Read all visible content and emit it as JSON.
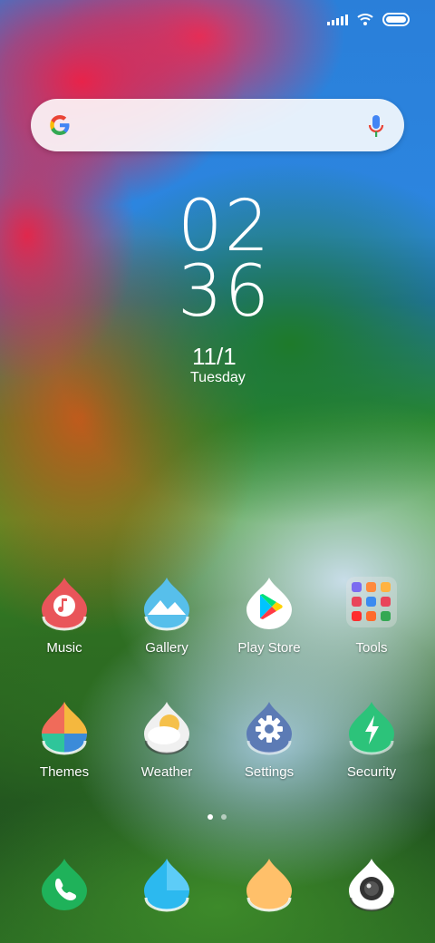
{
  "status_bar": {
    "signal_icon": "cellular-signal-icon",
    "wifi_icon": "wifi-icon",
    "battery_icon": "battery-icon"
  },
  "search_widget": {
    "logo": "google-g-logo",
    "mic_icon": "microphone-icon"
  },
  "clock": {
    "hours": "02",
    "minutes": "36",
    "date": "11/1",
    "day": "Tuesday"
  },
  "apps_row1": [
    {
      "label": "Music",
      "icon": "music-icon",
      "color": "#e9555a"
    },
    {
      "label": "Gallery",
      "icon": "gallery-icon",
      "color": "#2ea8e0"
    },
    {
      "label": "Play Store",
      "icon": "play-store-icon",
      "color": "#ffffff"
    },
    {
      "label": "Tools",
      "icon": "folder-icon",
      "color": "#d8d8d8"
    }
  ],
  "apps_row2": [
    {
      "label": "Themes",
      "icon": "themes-icon",
      "color": "#f06b5a"
    },
    {
      "label": "Weather",
      "icon": "weather-icon",
      "color": "#f0f0f0"
    },
    {
      "label": "Settings",
      "icon": "settings-icon",
      "color": "#5c7bb5"
    },
    {
      "label": "Security",
      "icon": "security-icon",
      "color": "#2cc37a"
    }
  ],
  "page_indicator": {
    "pages": 2,
    "current": 1
  },
  "dock": [
    {
      "icon": "phone-icon",
      "color": "#1fb25a"
    },
    {
      "icon": "messaging-icon",
      "color": "#2cb9ef"
    },
    {
      "icon": "browser-icon",
      "color": "#ffc06a"
    },
    {
      "icon": "camera-icon",
      "color": "#ffffff"
    }
  ]
}
